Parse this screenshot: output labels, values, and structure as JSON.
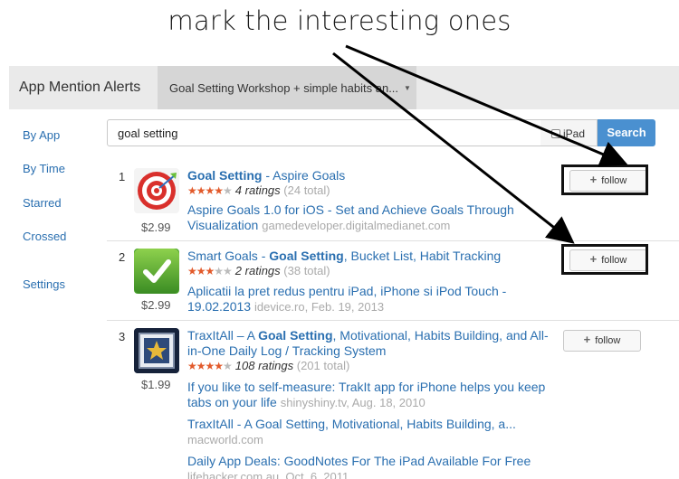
{
  "annotation": {
    "text": "mark the interesting ones"
  },
  "header": {
    "app_title": "App Mention Alerts",
    "workshop_tab": "Goal Setting Workshop + simple habits an..."
  },
  "sidebar": {
    "items": [
      {
        "label": "By App"
      },
      {
        "label": "By Time"
      },
      {
        "label": "Starred"
      },
      {
        "label": "Crossed"
      },
      {
        "label": "Settings"
      }
    ]
  },
  "search": {
    "value": "goal setting",
    "ipad_label": "iPad",
    "button_label": "Search"
  },
  "results": [
    {
      "rank": "1",
      "title_bold": "Goal Setting",
      "title_rest": " - Aspire Goals",
      "stars": 4.5,
      "ratings": "4 ratings",
      "total": "(24 total)",
      "price": "$2.99",
      "follow_label": "follow",
      "mentions": [
        {
          "text": "Aspire Goals 1.0 for iOS - Set and Achieve Goals Through Visualization",
          "source": "gamedeveloper.digitalmedianet.com"
        }
      ]
    },
    {
      "rank": "2",
      "title_pre": "Smart Goals - ",
      "title_bold": "Goal Setting",
      "title_rest": ", Bucket List, Habit Tracking",
      "stars": 3.5,
      "ratings": "2 ratings",
      "total": "(38 total)",
      "price": "$2.99",
      "follow_label": "follow",
      "mentions": [
        {
          "text": "Aplicatii la pret redus pentru iPad, iPhone si iPod Touch - 19.02.2013",
          "source": "idevice.ro, Feb. 19, 2013"
        }
      ]
    },
    {
      "rank": "3",
      "title_pre": "TraxItAll – A ",
      "title_bold": "Goal Setting",
      "title_rest": ", Motivational, Habits Building, and All-in-One Daily Log / Tracking System",
      "stars": 4.5,
      "ratings": "108 ratings",
      "total": "(201 total)",
      "price": "$1.99",
      "follow_label": "follow",
      "mentions": [
        {
          "text": "If you like to self-measure: TrakIt app for iPhone helps you keep tabs on your life",
          "source": "shinyshiny.tv, Aug. 18, 2010"
        },
        {
          "text": "TraxItAll - A Goal Setting, Motivational, Habits Building, a...",
          "source": "macworld.com"
        },
        {
          "text": "Daily App Deals: GoodNotes For The iPad Available For Free",
          "source": "lifehacker.com.au, Oct. 6, 2011"
        }
      ]
    }
  ],
  "colors": {
    "link": "#2a6fb0",
    "accent_button": "#4a90d0",
    "stars": "#e25a2b",
    "muted": "#aaaaaa",
    "header_bg": "#eaeaea"
  },
  "icons": {
    "result_1": "target-icon",
    "result_2": "checkmark-icon",
    "result_3": "star-frame-icon",
    "follow": "plus-icon"
  }
}
